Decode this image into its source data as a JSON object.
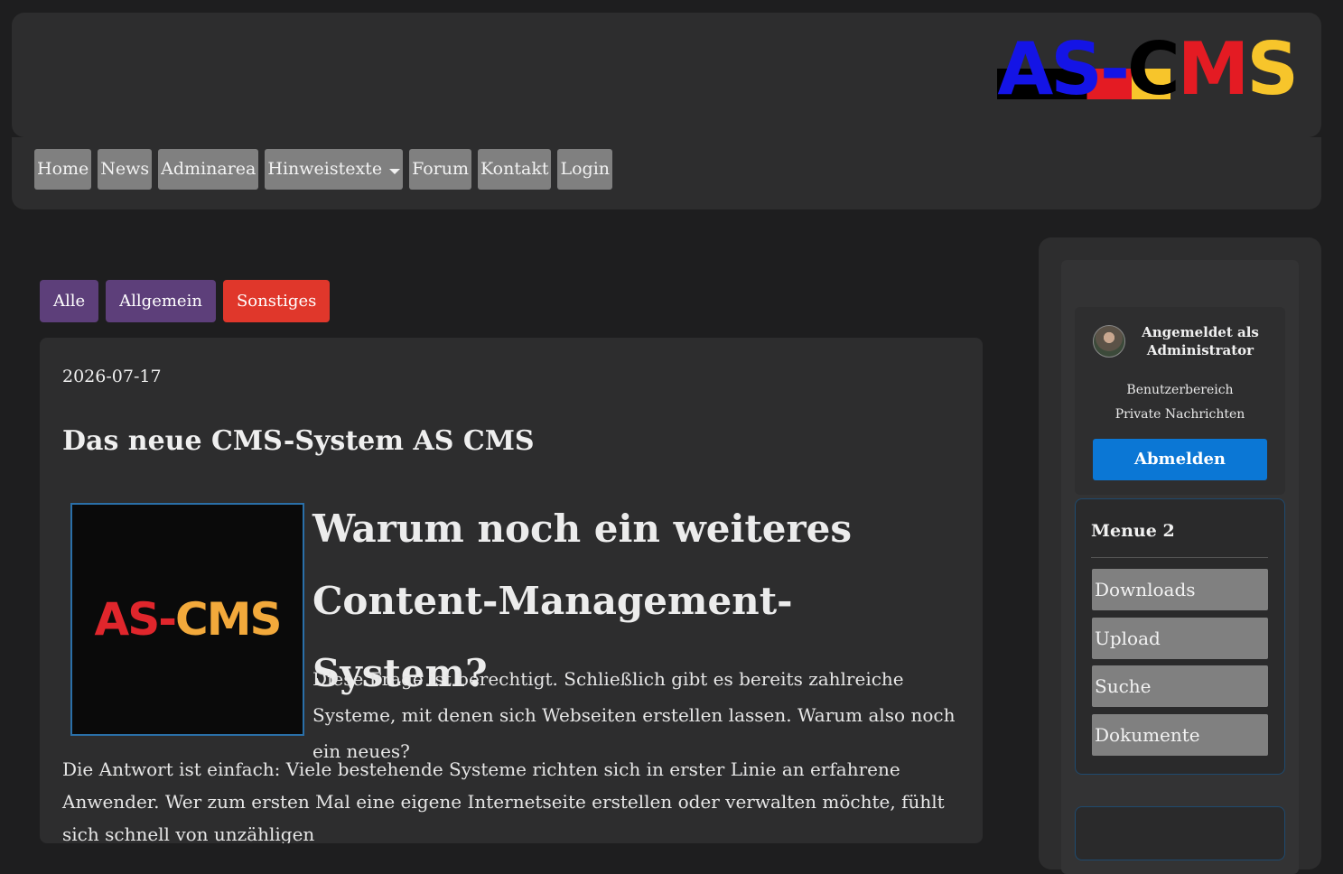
{
  "header": {
    "logo": {
      "part1": "AS",
      "dash": "-",
      "part2": "C",
      "part3": "M",
      "part4": "S",
      "colors": [
        "#1414e6",
        "#e41b23",
        "#000000",
        "#f7c52b"
      ]
    }
  },
  "nav": {
    "items": [
      {
        "label": "Home"
      },
      {
        "label": "News"
      },
      {
        "label": "Adminarea"
      },
      {
        "label": "Hinweistexte"
      },
      {
        "label": "Forum"
      },
      {
        "label": "Kontakt"
      },
      {
        "label": "Login"
      }
    ]
  },
  "filters": [
    {
      "label": "Alle",
      "color": "#5d3f7a"
    },
    {
      "label": "Allgemein",
      "color": "#5d3f7a"
    },
    {
      "label": "Sonstiges",
      "color": "#e0372b"
    }
  ],
  "article": {
    "date": "2026-07-17",
    "title": "Das neue CMS-System AS CMS",
    "image_text": {
      "part1": "AS",
      "dash": "-",
      "part2": "CMS"
    },
    "heading": "Warum noch ein weiteres Content-Management-System?",
    "para1": "Diese Frage ist berechtigt. Schließlich gibt es bereits zahlreiche Systeme, mit denen sich Webseiten erstellen lassen. Warum also noch ein neues?",
    "para2": "Die Antwort ist einfach: Viele bestehende Systeme richten sich in erster Linie an erfahrene Anwender. Wer zum ersten Mal eine eigene Internetseite erstellen oder verwalten möchte, fühlt sich schnell von unzähligen"
  },
  "sidebar": {
    "user": {
      "logged_in": "Angemeldet als Administrator",
      "user_area": "Benutzerbereich",
      "messages": "Private Nachrichten",
      "logout": "Abmelden"
    },
    "menu2": {
      "title": "Menue 2",
      "items": [
        {
          "label": "Downloads"
        },
        {
          "label": "Upload"
        },
        {
          "label": "Suche"
        },
        {
          "label": "Dokumente"
        }
      ]
    }
  }
}
